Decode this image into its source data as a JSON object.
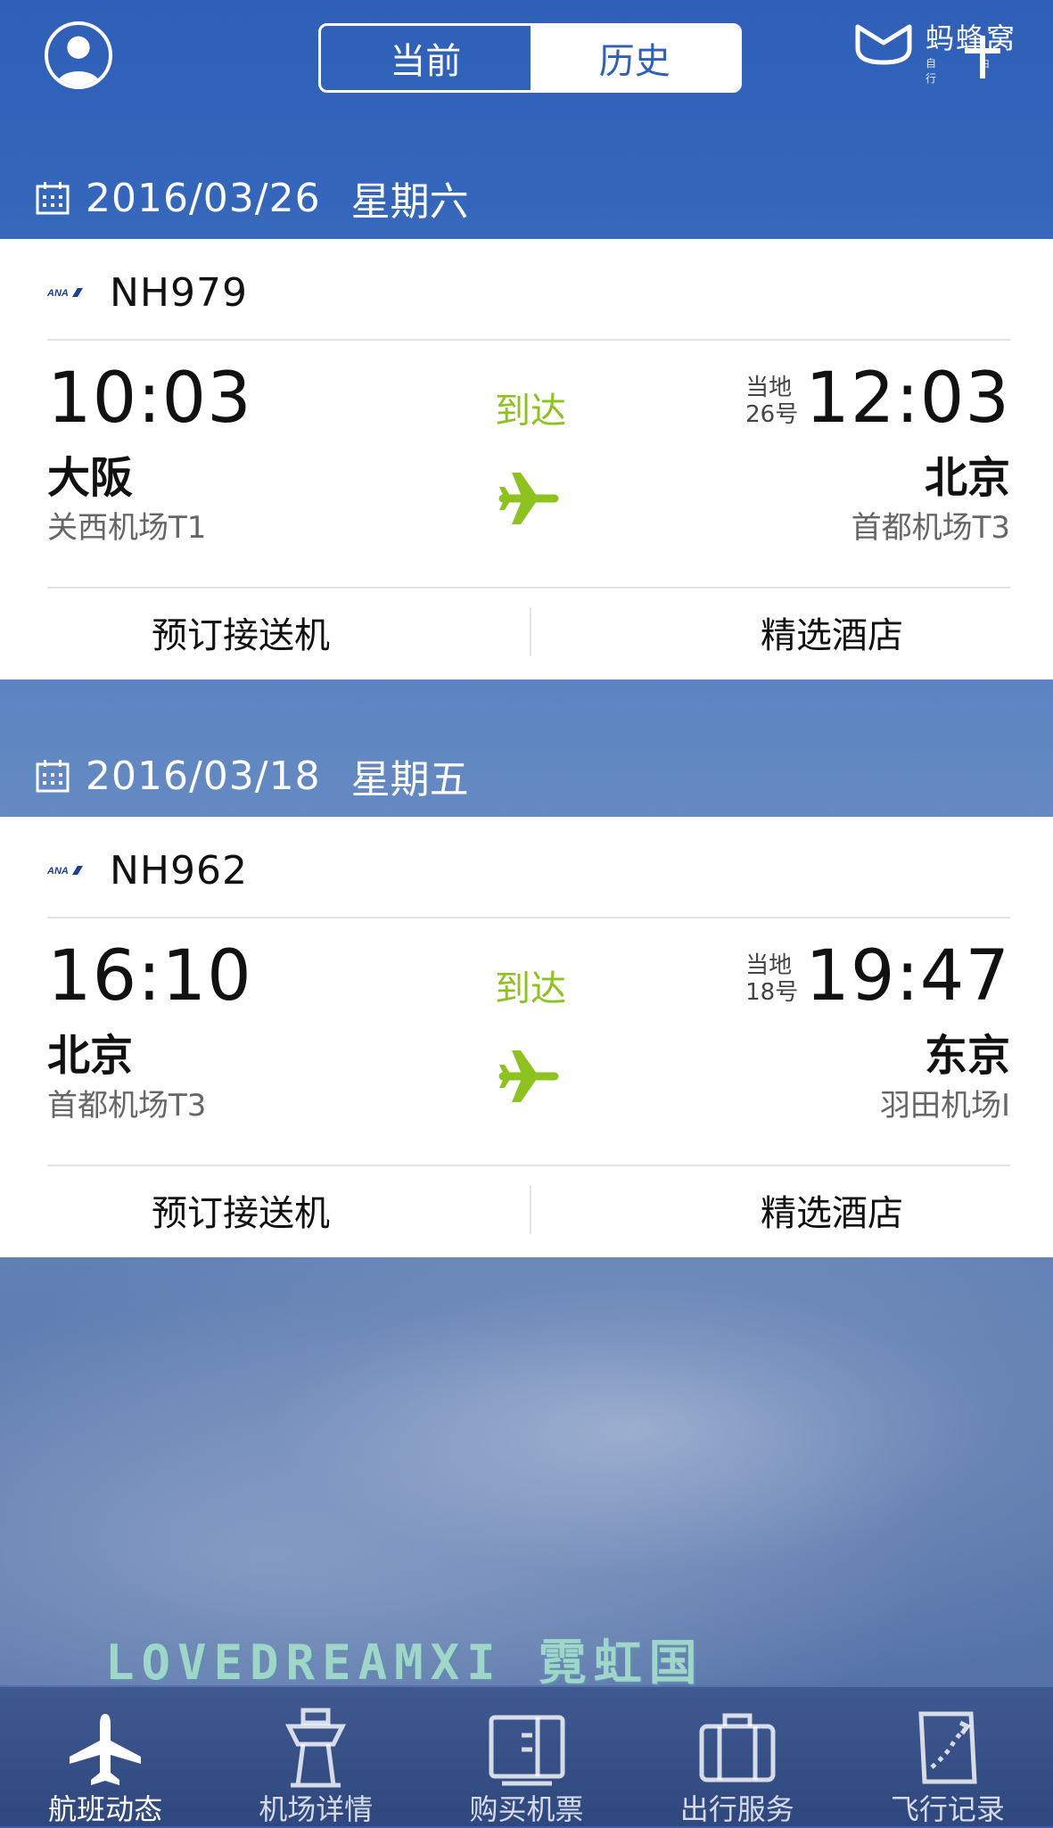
{
  "header": {
    "tabs": [
      {
        "label": "当前",
        "active": false
      },
      {
        "label": "历史",
        "active": true
      }
    ],
    "brand": {
      "name": "蚂蜂窝",
      "sub": "自 由 行"
    }
  },
  "flights": [
    {
      "date": "2016/03/26",
      "weekday": "星期六",
      "flight_no": "NH979",
      "dep_time": "10:03",
      "dep_city": "大阪",
      "dep_airport": "关西机场T1",
      "status": "到达",
      "local_label": "当地",
      "local_day": "26号",
      "arr_time": "12:03",
      "arr_city": "北京",
      "arr_airport": "首都机场T3",
      "action_left": "预订接送机",
      "action_right": "精选酒店"
    },
    {
      "date": "2016/03/18",
      "weekday": "星期五",
      "flight_no": "NH962",
      "dep_time": "16:10",
      "dep_city": "北京",
      "dep_airport": "首都机场T3",
      "status": "到达",
      "local_label": "当地",
      "local_day": "18号",
      "arr_time": "19:47",
      "arr_city": "东京",
      "arr_airport": "羽田机场I",
      "action_left": "预订接送机",
      "action_right": "精选酒店"
    }
  ],
  "watermark": {
    "text": "LOVEDREAMXI",
    "cn": "霓虹国"
  },
  "bottom_nav": [
    {
      "label": "航班动态",
      "icon": "plane-icon",
      "active": true
    },
    {
      "label": "机场详情",
      "icon": "tower-icon",
      "active": false
    },
    {
      "label": "购买机票",
      "icon": "ticket-icon",
      "active": false
    },
    {
      "label": "出行服务",
      "icon": "suitcase-icon",
      "active": false
    },
    {
      "label": "飞行记录",
      "icon": "map-icon",
      "active": false
    }
  ],
  "colors": {
    "accent_green": "#8dc21f",
    "header_blue": "#2f5fb8"
  }
}
